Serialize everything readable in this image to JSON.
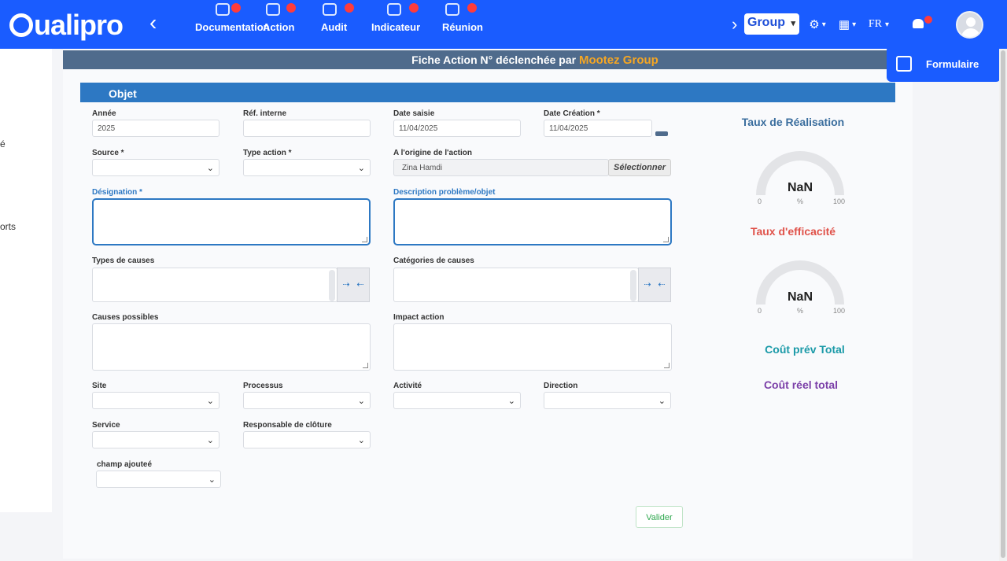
{
  "header": {
    "logo_text": "ualipro",
    "collapse_icon": "‹",
    "nav": [
      {
        "label": "Documentation",
        "badge": true
      },
      {
        "label": "Action",
        "badge": true
      },
      {
        "label": "Audit",
        "badge": true
      },
      {
        "label": "Indicateur",
        "badge": true
      },
      {
        "label": "Réunion",
        "badge": true
      }
    ],
    "group_value": "Group",
    "lang": "FR",
    "colors": {
      "bar": "#1a5cff",
      "badge": "#ff3b3b"
    }
  },
  "sidebar": {
    "items": [
      "é",
      "orts"
    ]
  },
  "page": {
    "title_prefix": "Fiche Action N° déclenchée par",
    "title_highlight": "Mootez Group",
    "formulaire_label": "Formulaire",
    "section_title": "Objet"
  },
  "form": {
    "annee": {
      "label": "Année",
      "value": "2025"
    },
    "ref_interne": {
      "label": "Réf. interne",
      "value": ""
    },
    "date_saisie": {
      "label": "Date saisie",
      "value": "11/04/2025"
    },
    "date_creation": {
      "label": "Date Création *",
      "value": "11/04/2025"
    },
    "source": {
      "label": "Source *",
      "value": ""
    },
    "type_action": {
      "label": "Type action *",
      "value": ""
    },
    "origine": {
      "label": "A l'origine de l'action",
      "value": "Zina Hamdi"
    },
    "selectionner": "Sélectionner",
    "designation": {
      "label": "Désignation *"
    },
    "description": {
      "label": "Description problème/objet"
    },
    "types_causes": {
      "label": "Types de causes"
    },
    "categories_causes": {
      "label": "Catégories de causes"
    },
    "causes_possibles": {
      "label": "Causes possibles"
    },
    "impact_action": {
      "label": "Impact action"
    },
    "site": {
      "label": "Site"
    },
    "processus": {
      "label": "Processus"
    },
    "activite": {
      "label": "Activité"
    },
    "direction": {
      "label": "Direction"
    },
    "service": {
      "label": "Service"
    },
    "responsable": {
      "label": "Responsable de clôture"
    },
    "champ_ajoute": {
      "label": "champ ajouteé"
    },
    "valider": "Valider"
  },
  "stats": {
    "taux_realisation": {
      "title": "Taux de Réalisation",
      "value": "NaN",
      "min": "0",
      "unit": "%",
      "max": "100",
      "color": "#3b6e9e"
    },
    "taux_efficacite": {
      "title": "Taux d'efficacité",
      "value": "NaN",
      "min": "0",
      "unit": "%",
      "max": "100",
      "color": "#e0524a"
    },
    "cout_prev": {
      "title": "Coût prév Total",
      "color": "#1b9aa8"
    },
    "cout_reel": {
      "title": "Coût réel total",
      "color": "#7b3fa8"
    }
  }
}
